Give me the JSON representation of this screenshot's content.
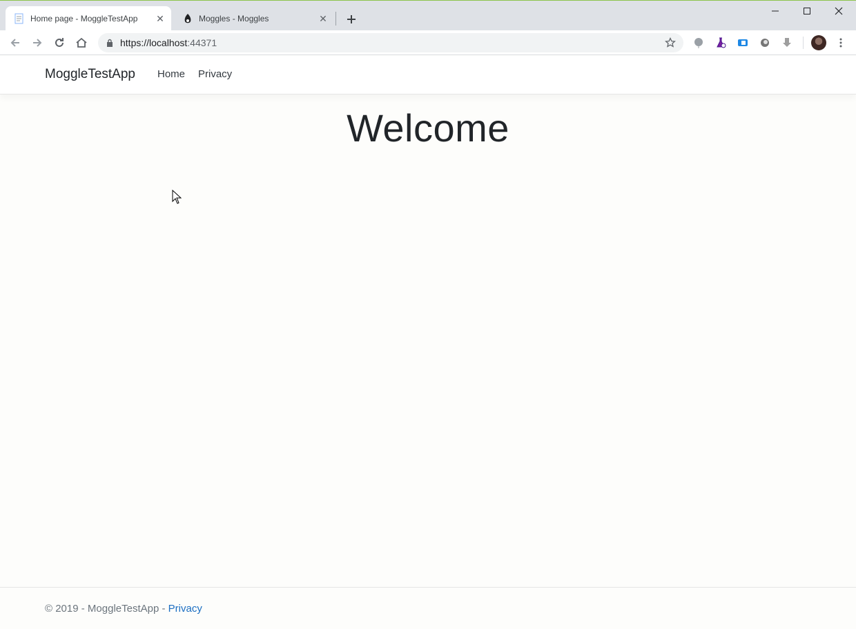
{
  "browser": {
    "tabs": [
      {
        "title": "Home page - MoggleTestApp",
        "active": true
      },
      {
        "title": "Moggles - Moggles",
        "active": false
      }
    ],
    "url": {
      "host": "https://localhost",
      "port": ":44371"
    }
  },
  "navbar": {
    "brand": "MoggleTestApp",
    "links": [
      "Home",
      "Privacy"
    ]
  },
  "main": {
    "heading": "Welcome"
  },
  "footer": {
    "prefix": "© 2019 - MoggleTestApp - ",
    "link": "Privacy"
  },
  "colors": {
    "link": "#1b6ec2",
    "chrome_bg": "#dee1e6"
  }
}
